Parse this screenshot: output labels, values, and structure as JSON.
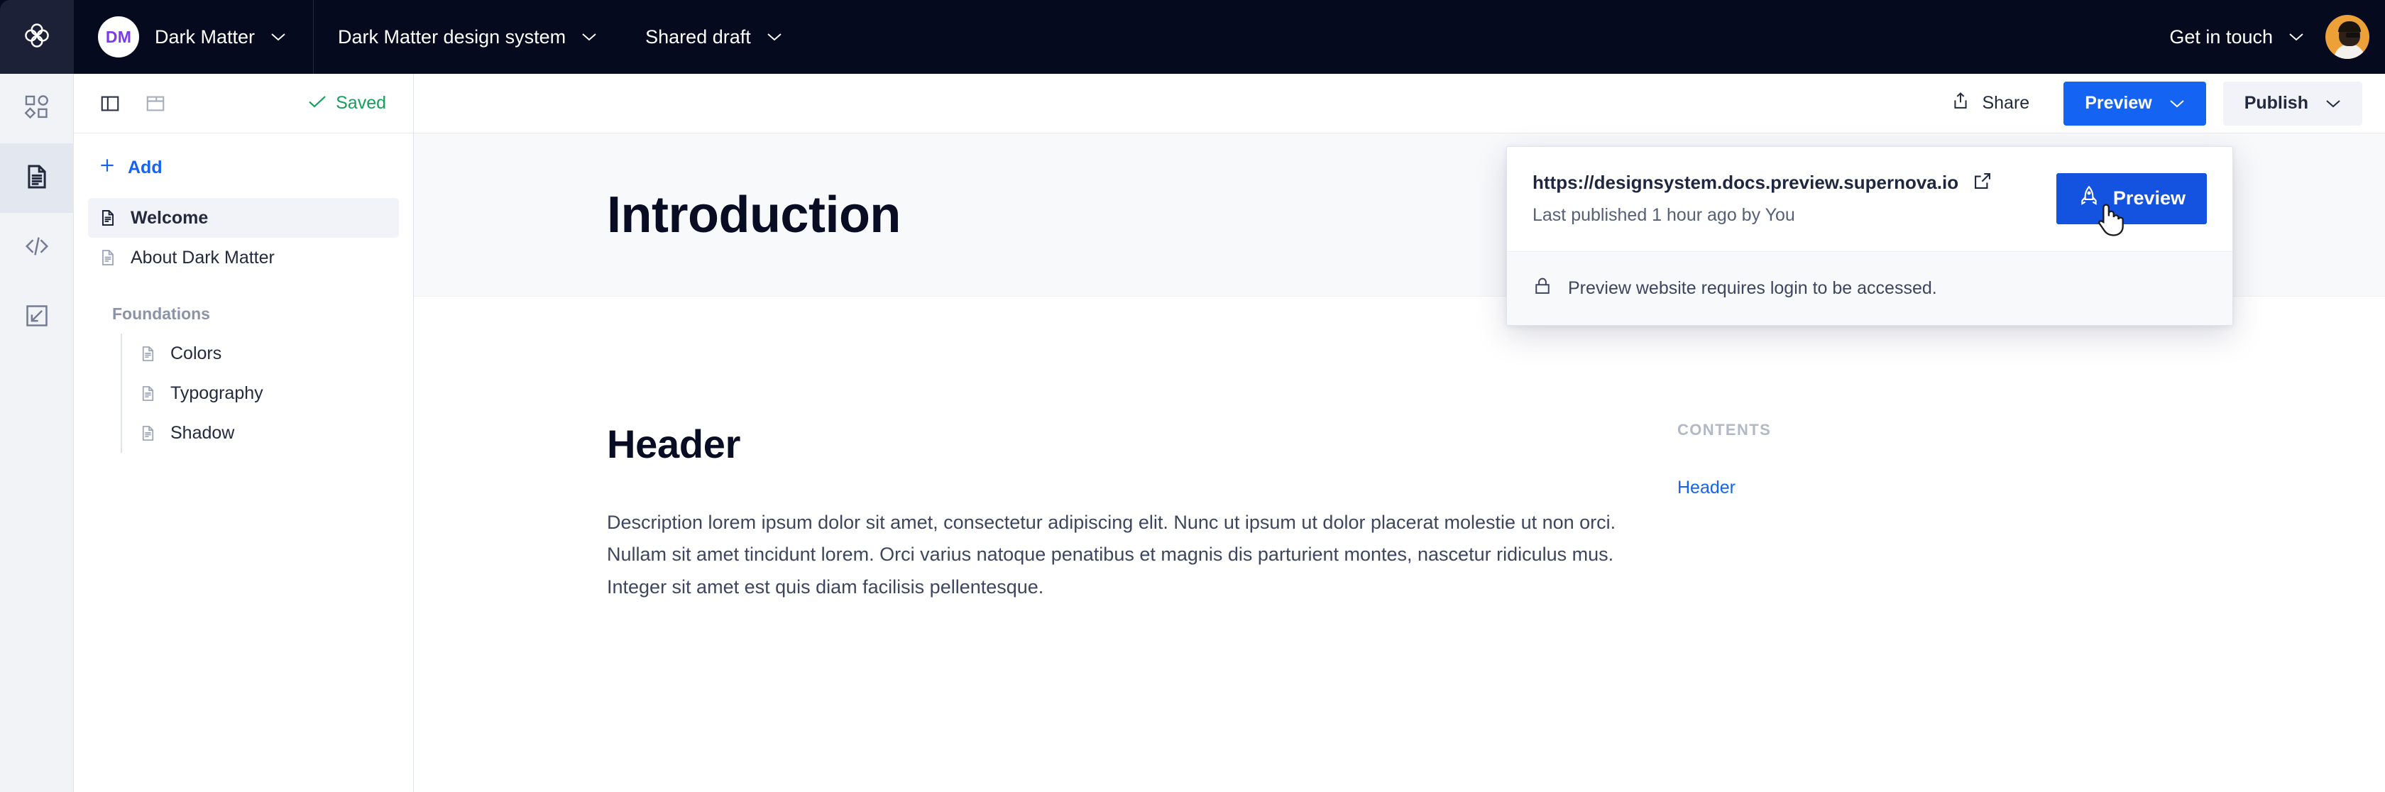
{
  "topbar": {
    "logo_icon": "supernova-logo-icon",
    "workspace": {
      "initials": "DM",
      "name": "Dark Matter",
      "chevron": "chevron-down-icon"
    },
    "design_system": {
      "name": "Dark Matter design system",
      "chevron": "chevron-down-icon"
    },
    "version": {
      "name": "Shared draft",
      "chevron": "chevron-down-icon"
    },
    "get_in_touch": {
      "label": "Get in touch",
      "chevron": "chevron-down-icon"
    },
    "avatar": "user-avatar",
    "bg_color": "#050A1F"
  },
  "rail": {
    "items": [
      {
        "name": "components",
        "icon": "shapes-icon",
        "active": false
      },
      {
        "name": "documentation",
        "icon": "document-icon",
        "active": true
      },
      {
        "name": "code",
        "icon": "code-brackets-icon",
        "active": false
      },
      {
        "name": "import-export",
        "icon": "import-arrow-icon",
        "active": false
      }
    ]
  },
  "sidebar": {
    "toolbar": {
      "panel_left_icon": "panel-left-icon",
      "panel_top_icon": "panel-top-icon",
      "saved_label": "Saved",
      "saved_icon": "check-icon",
      "saved_color": "#14A05A"
    },
    "add_label": "Add",
    "add_icon": "plus-icon",
    "pages": [
      {
        "label": "Welcome",
        "icon": "page-icon",
        "selected": true
      },
      {
        "label": "About Dark Matter",
        "icon": "page-icon",
        "selected": false
      }
    ],
    "group": {
      "label": "Foundations",
      "children": [
        {
          "label": "Colors",
          "icon": "page-icon"
        },
        {
          "label": "Typography",
          "icon": "page-icon"
        },
        {
          "label": "Shadow",
          "icon": "page-icon"
        }
      ]
    }
  },
  "editor_toolbar": {
    "share": {
      "label": "Share",
      "icon": "share-upload-icon"
    },
    "preview": {
      "label": "Preview",
      "chevron": "chevron-down-icon",
      "color": "#1463F3"
    },
    "publish": {
      "label": "Publish",
      "chevron": "chevron-down-icon"
    }
  },
  "document": {
    "hero_title": "Introduction",
    "header": "Header",
    "paragraph": "Description lorem ipsum dolor sit amet, consectetur adipiscing elit. Nunc ut ipsum ut dolor placerat molestie ut non orci. Nullam sit amet tincidunt lorem. Orci varius natoque penatibus et magnis dis parturient montes, nascetur ridiculus mus. Integer sit amet est quis diam facilisis pellentesque."
  },
  "contents": {
    "title": "CONTENTS",
    "links": [
      {
        "label": "Header"
      }
    ]
  },
  "preview_popover": {
    "url": "https://designsystem.docs.preview.supernova.io",
    "external_icon": "external-link-icon",
    "last_published": "Last published 1 hour ago by You",
    "preview_button": {
      "label": "Preview",
      "icon": "rocket-icon"
    },
    "notice": {
      "text": "Preview website requires login to be accessed.",
      "icon": "lock-icon"
    },
    "cursor": "hand-cursor-icon"
  }
}
